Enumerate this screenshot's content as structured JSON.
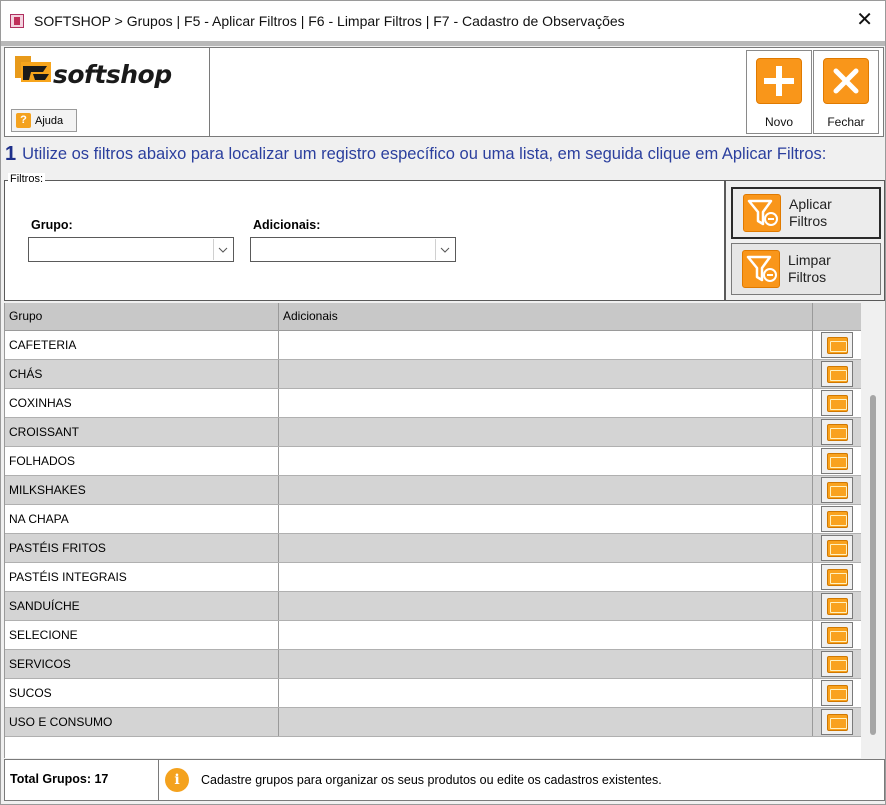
{
  "window": {
    "title": "SOFTSHOP > Grupos | F5 - Aplicar Filtros | F6 - Limpar Filtros | F7 - Cadastro de Observações",
    "close_glyph": "✕"
  },
  "header": {
    "logo_text": "softshop",
    "help_label": "Ajuda",
    "help_glyph": "?",
    "actions": [
      {
        "label": "Novo",
        "icon": "plus-icon"
      },
      {
        "label": "Fechar",
        "icon": "close-x-icon"
      }
    ],
    "accent_color": "#f9961a"
  },
  "instruction": {
    "number": "1",
    "text": "Utilize os filtros abaixo para localizar um registro específico ou uma lista, em seguida clique em Aplicar Filtros:"
  },
  "filters": {
    "legend": "Filtros:",
    "fields": [
      {
        "label": "Grupo:",
        "value": ""
      },
      {
        "label": "Adicionais:",
        "value": ""
      }
    ],
    "apply_label_1": "Aplicar",
    "apply_label_2": "Filtros",
    "clear_label_1": "Limpar",
    "clear_label_2": "Filtros"
  },
  "grid": {
    "columns": [
      "Grupo",
      "Adicionais",
      ""
    ],
    "rows": [
      {
        "grupo": "CAFETERIA",
        "adicionais": ""
      },
      {
        "grupo": "CHÁS",
        "adicionais": ""
      },
      {
        "grupo": "COXINHAS",
        "adicionais": ""
      },
      {
        "grupo": "CROISSANT",
        "adicionais": ""
      },
      {
        "grupo": "FOLHADOS",
        "adicionais": ""
      },
      {
        "grupo": "MILKSHAKES",
        "adicionais": ""
      },
      {
        "grupo": "NA CHAPA",
        "adicionais": ""
      },
      {
        "grupo": "PASTÉIS FRITOS",
        "adicionais": ""
      },
      {
        "grupo": "PASTÉIS INTEGRAIS",
        "adicionais": ""
      },
      {
        "grupo": "SANDUÍCHE",
        "adicionais": ""
      },
      {
        "grupo": "SELECIONE",
        "adicionais": ""
      },
      {
        "grupo": "SERVICOS",
        "adicionais": ""
      },
      {
        "grupo": "SUCOS",
        "adicionais": ""
      },
      {
        "grupo": "USO E CONSUMO",
        "adicionais": ""
      }
    ]
  },
  "status": {
    "total": "Total Grupos: 17",
    "info_glyph": "i",
    "message": "Cadastre grupos para organizar os seus produtos ou edite os cadastros existentes."
  }
}
